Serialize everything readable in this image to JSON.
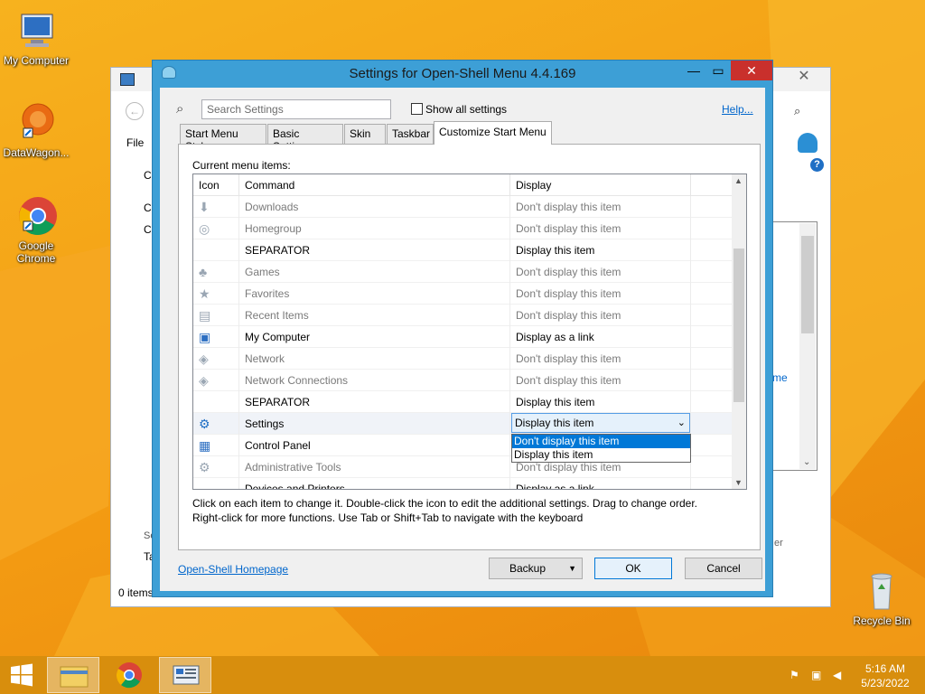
{
  "desktop": {
    "icons": [
      {
        "label": "My Computer"
      },
      {
        "label": "DataWagon..."
      },
      {
        "label": "Google Chrome"
      },
      {
        "label": "Recycle Bin"
      }
    ]
  },
  "bg_window": {
    "menu_file": "File",
    "status": "0 items",
    "partial_c1": "C",
    "partial_c2": "C",
    "partial_c3": "C",
    "partial_se": "Se",
    "partial_ta": "Ta",
    "partial_me": "me",
    "partial_er": "er"
  },
  "dialog": {
    "title": "Settings for Open-Shell Menu 4.4.169",
    "search_placeholder": "Search Settings",
    "show_all_label": "Show all settings",
    "help_link": "Help...",
    "tabs": [
      {
        "label": "Start Menu Style"
      },
      {
        "label": "Basic Settings"
      },
      {
        "label": "Skin"
      },
      {
        "label": "Taskbar"
      },
      {
        "label": "Customize Start Menu"
      }
    ],
    "current_items_label": "Current menu items:",
    "columns": [
      "Icon",
      "Command",
      "Display"
    ],
    "rows": [
      {
        "command": "Downloads",
        "display": "Don't display this item",
        "icon": "downloads-icon",
        "dim": true
      },
      {
        "command": "Homegroup",
        "display": "Don't display this item",
        "icon": "homegroup-icon",
        "dim": true
      },
      {
        "command": "SEPARATOR",
        "display": "Display this item",
        "icon": "",
        "dim": false
      },
      {
        "command": "Games",
        "display": "Don't display this item",
        "icon": "games-icon",
        "dim": true
      },
      {
        "command": "Favorites",
        "display": "Don't display this item",
        "icon": "star-icon",
        "dim": true
      },
      {
        "command": "Recent Items",
        "display": "Don't display this item",
        "icon": "recent-items-icon",
        "dim": true
      },
      {
        "command": "My Computer",
        "display": "Display as a link",
        "icon": "computer-icon",
        "dim": false
      },
      {
        "command": "Network",
        "display": "Don't display this item",
        "icon": "network-icon",
        "dim": true
      },
      {
        "command": "Network Connections",
        "display": "Don't display this item",
        "icon": "network-connections-icon",
        "dim": true
      },
      {
        "command": "SEPARATOR",
        "display": "Display this item",
        "icon": "",
        "dim": false
      },
      {
        "command": "Settings",
        "display": "Display this item",
        "icon": "gear-icon",
        "dim": false
      },
      {
        "command": "Control Panel",
        "display": "Display this item",
        "icon": "control-panel-icon",
        "dim": false
      },
      {
        "command": "Administrative Tools",
        "display": "Don't display this item",
        "icon": "admin-tools-icon",
        "dim": true
      },
      {
        "command": "Devices and Printers",
        "display": "Display as a link",
        "icon": "printer-icon",
        "dim": false
      }
    ],
    "combo_value": "Display this item",
    "dropdown_options": [
      "Don't display this item",
      "Display this item"
    ],
    "instructions_1": "Click on each item to change it. Double-click the icon to edit the additional settings. Drag to change order.",
    "instructions_2": "Right-click for more functions. Use Tab or Shift+Tab to navigate with the keyboard",
    "homepage_link": "Open-Shell Homepage",
    "backup_button": "Backup",
    "ok_button": "OK",
    "cancel_button": "Cancel"
  },
  "taskbar": {
    "time": "5:16 AM",
    "date": "5/23/2022"
  },
  "colors": {
    "accent": "#3d9fd6",
    "close": "#c9302c",
    "taskbar": "#d88e0d"
  }
}
